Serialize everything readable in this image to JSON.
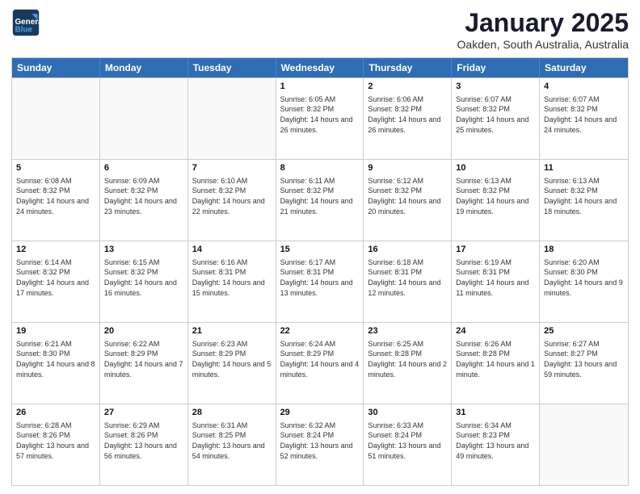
{
  "header": {
    "logo_line1": "General",
    "logo_line2": "Blue",
    "month": "January 2025",
    "location": "Oakden, South Australia, Australia"
  },
  "weekdays": [
    "Sunday",
    "Monday",
    "Tuesday",
    "Wednesday",
    "Thursday",
    "Friday",
    "Saturday"
  ],
  "weeks": [
    [
      {
        "day": "",
        "empty": true
      },
      {
        "day": "",
        "empty": true
      },
      {
        "day": "",
        "empty": true
      },
      {
        "day": "1",
        "sunrise": "6:05 AM",
        "sunset": "8:32 PM",
        "daylight": "14 hours and 26 minutes."
      },
      {
        "day": "2",
        "sunrise": "6:06 AM",
        "sunset": "8:32 PM",
        "daylight": "14 hours and 26 minutes."
      },
      {
        "day": "3",
        "sunrise": "6:07 AM",
        "sunset": "8:32 PM",
        "daylight": "14 hours and 25 minutes."
      },
      {
        "day": "4",
        "sunrise": "6:07 AM",
        "sunset": "8:32 PM",
        "daylight": "14 hours and 24 minutes."
      }
    ],
    [
      {
        "day": "5",
        "sunrise": "6:08 AM",
        "sunset": "8:32 PM",
        "daylight": "14 hours and 24 minutes."
      },
      {
        "day": "6",
        "sunrise": "6:09 AM",
        "sunset": "8:32 PM",
        "daylight": "14 hours and 23 minutes."
      },
      {
        "day": "7",
        "sunrise": "6:10 AM",
        "sunset": "8:32 PM",
        "daylight": "14 hours and 22 minutes."
      },
      {
        "day": "8",
        "sunrise": "6:11 AM",
        "sunset": "8:32 PM",
        "daylight": "14 hours and 21 minutes."
      },
      {
        "day": "9",
        "sunrise": "6:12 AM",
        "sunset": "8:32 PM",
        "daylight": "14 hours and 20 minutes."
      },
      {
        "day": "10",
        "sunrise": "6:13 AM",
        "sunset": "8:32 PM",
        "daylight": "14 hours and 19 minutes."
      },
      {
        "day": "11",
        "sunrise": "6:13 AM",
        "sunset": "8:32 PM",
        "daylight": "14 hours and 18 minutes."
      }
    ],
    [
      {
        "day": "12",
        "sunrise": "6:14 AM",
        "sunset": "8:32 PM",
        "daylight": "14 hours and 17 minutes."
      },
      {
        "day": "13",
        "sunrise": "6:15 AM",
        "sunset": "8:32 PM",
        "daylight": "14 hours and 16 minutes."
      },
      {
        "day": "14",
        "sunrise": "6:16 AM",
        "sunset": "8:31 PM",
        "daylight": "14 hours and 15 minutes."
      },
      {
        "day": "15",
        "sunrise": "6:17 AM",
        "sunset": "8:31 PM",
        "daylight": "14 hours and 13 minutes."
      },
      {
        "day": "16",
        "sunrise": "6:18 AM",
        "sunset": "8:31 PM",
        "daylight": "14 hours and 12 minutes."
      },
      {
        "day": "17",
        "sunrise": "6:19 AM",
        "sunset": "8:31 PM",
        "daylight": "14 hours and 11 minutes."
      },
      {
        "day": "18",
        "sunrise": "6:20 AM",
        "sunset": "8:30 PM",
        "daylight": "14 hours and 9 minutes."
      }
    ],
    [
      {
        "day": "19",
        "sunrise": "6:21 AM",
        "sunset": "8:30 PM",
        "daylight": "14 hours and 8 minutes."
      },
      {
        "day": "20",
        "sunrise": "6:22 AM",
        "sunset": "8:29 PM",
        "daylight": "14 hours and 7 minutes."
      },
      {
        "day": "21",
        "sunrise": "6:23 AM",
        "sunset": "8:29 PM",
        "daylight": "14 hours and 5 minutes."
      },
      {
        "day": "22",
        "sunrise": "6:24 AM",
        "sunset": "8:29 PM",
        "daylight": "14 hours and 4 minutes."
      },
      {
        "day": "23",
        "sunrise": "6:25 AM",
        "sunset": "8:28 PM",
        "daylight": "14 hours and 2 minutes."
      },
      {
        "day": "24",
        "sunrise": "6:26 AM",
        "sunset": "8:28 PM",
        "daylight": "14 hours and 1 minute."
      },
      {
        "day": "25",
        "sunrise": "6:27 AM",
        "sunset": "8:27 PM",
        "daylight": "13 hours and 59 minutes."
      }
    ],
    [
      {
        "day": "26",
        "sunrise": "6:28 AM",
        "sunset": "8:26 PM",
        "daylight": "13 hours and 57 minutes."
      },
      {
        "day": "27",
        "sunrise": "6:29 AM",
        "sunset": "8:26 PM",
        "daylight": "13 hours and 56 minutes."
      },
      {
        "day": "28",
        "sunrise": "6:31 AM",
        "sunset": "8:25 PM",
        "daylight": "13 hours and 54 minutes."
      },
      {
        "day": "29",
        "sunrise": "6:32 AM",
        "sunset": "8:24 PM",
        "daylight": "13 hours and 52 minutes."
      },
      {
        "day": "30",
        "sunrise": "6:33 AM",
        "sunset": "8:24 PM",
        "daylight": "13 hours and 51 minutes."
      },
      {
        "day": "31",
        "sunrise": "6:34 AM",
        "sunset": "8:23 PM",
        "daylight": "13 hours and 49 minutes."
      },
      {
        "day": "",
        "empty": true
      }
    ]
  ]
}
